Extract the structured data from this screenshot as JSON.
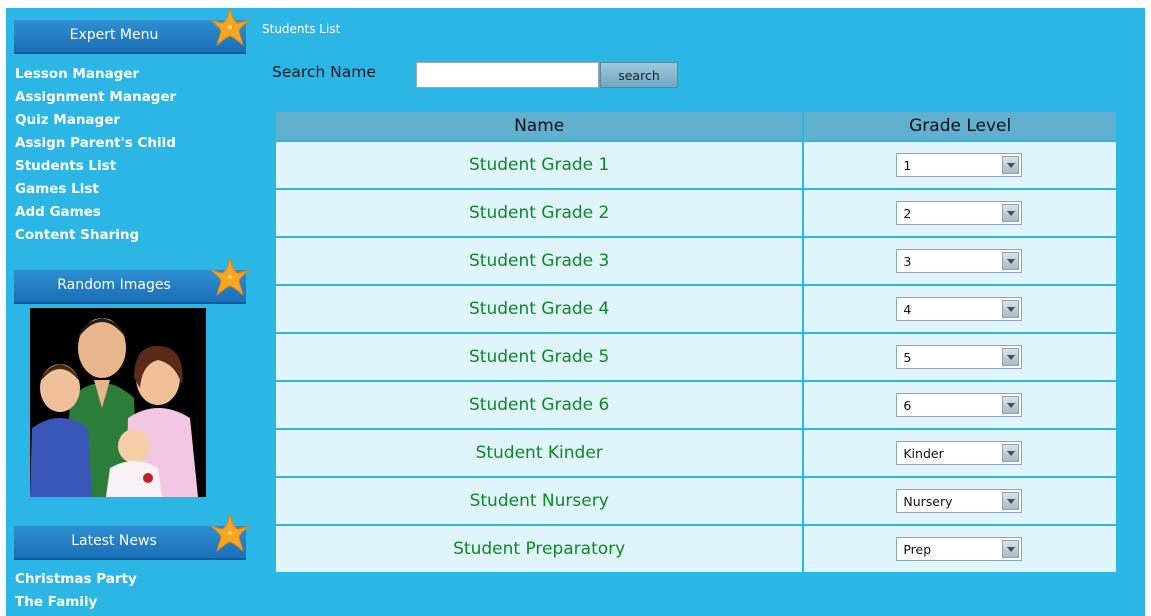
{
  "sidebar": {
    "expert_menu": {
      "title": "Expert Menu",
      "items": [
        "Lesson Manager",
        "Assignment Manager",
        "Quiz Manager",
        "Assign Parent's Child",
        "Students List",
        "Games List",
        "Add Games",
        "Content Sharing"
      ]
    },
    "random_images": {
      "title": "Random Images",
      "image": "family-clipart"
    },
    "latest_news": {
      "title": "Latest News",
      "items": [
        "Christmas Party",
        "The Family"
      ]
    },
    "star_icon": "starfish-icon"
  },
  "main": {
    "breadcrumb": "Students List",
    "search": {
      "label": "Search Name",
      "value": "",
      "button": "search"
    },
    "table": {
      "headers": [
        "Name",
        "Grade Level"
      ],
      "rows": [
        {
          "name": "Student Grade 1",
          "grade": "1"
        },
        {
          "name": "Student Grade 2",
          "grade": "2"
        },
        {
          "name": "Student Grade 3",
          "grade": "3"
        },
        {
          "name": "Student Grade 4",
          "grade": "4"
        },
        {
          "name": "Student Grade 5",
          "grade": "5"
        },
        {
          "name": "Student Grade 6",
          "grade": "6"
        },
        {
          "name": "Student Kinder",
          "grade": "Kinder"
        },
        {
          "name": "Student Nursery",
          "grade": "Nursery"
        },
        {
          "name": "Student Preparatory",
          "grade": "Prep"
        }
      ]
    }
  },
  "colors": {
    "page_bg": "#2cb6e6",
    "header_bg": "#62b0d0",
    "row_bg": "#e0f4fb",
    "name_text": "#0b8a1f",
    "section_header": "#1a6fb6",
    "star": "#f5a623"
  }
}
